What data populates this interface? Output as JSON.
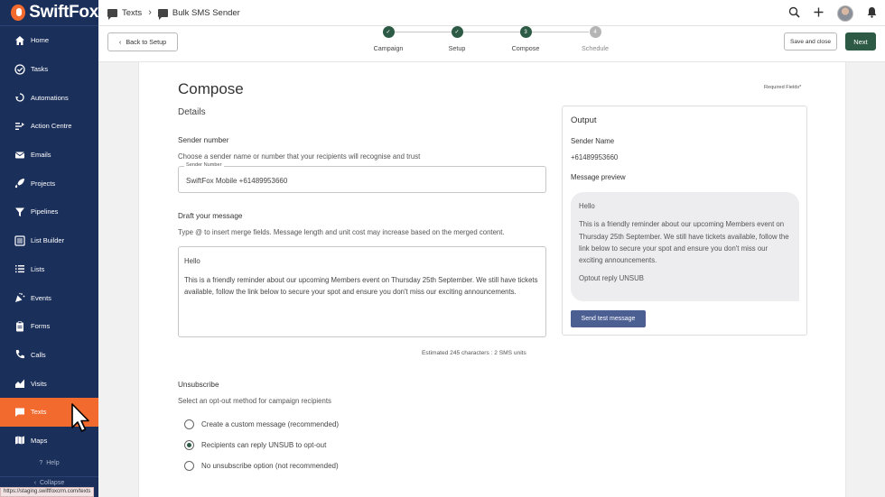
{
  "app": {
    "name": "SwiftFox"
  },
  "sidebar": {
    "items": [
      {
        "label": "Home",
        "icon": "home-icon"
      },
      {
        "label": "Tasks",
        "icon": "check-circle-icon"
      },
      {
        "label": "Automations",
        "icon": "refresh-icon"
      },
      {
        "label": "Action Centre",
        "icon": "action-centre-icon"
      },
      {
        "label": "Emails",
        "icon": "envelope-icon"
      },
      {
        "label": "Projects",
        "icon": "rocket-icon"
      },
      {
        "label": "Pipelines",
        "icon": "filter-icon"
      },
      {
        "label": "List Builder",
        "icon": "list-builder-icon"
      },
      {
        "label": "Lists",
        "icon": "list-icon"
      },
      {
        "label": "Events",
        "icon": "party-icon"
      },
      {
        "label": "Forms",
        "icon": "clipboard-icon"
      },
      {
        "label": "Calls",
        "icon": "phone-icon"
      },
      {
        "label": "Visits",
        "icon": "chart-icon"
      },
      {
        "label": "Texts",
        "icon": "message-icon",
        "active": true
      },
      {
        "label": "Maps",
        "icon": "map-icon"
      }
    ],
    "help": "Help",
    "collapse": "Collapse"
  },
  "breadcrumb": {
    "first": "Texts",
    "second": "Bulk SMS Sender"
  },
  "stepbar": {
    "back": "Back to Setup",
    "save": "Save and close",
    "next": "Next",
    "steps": [
      {
        "label": "Campaign",
        "num": ""
      },
      {
        "label": "Setup",
        "num": ""
      },
      {
        "label": "Compose",
        "num": "3"
      },
      {
        "label": "Schedule",
        "num": "4"
      }
    ]
  },
  "compose": {
    "title": "Compose",
    "required": "Required Fields*",
    "details": "Details",
    "sender_label": "Sender number",
    "sender_help": "Choose a sender name or number that your recipients will recognise and trust",
    "sender_field_label": "Sender Number",
    "sender_value": "SwiftFox Mobile +61489953660",
    "draft_label": "Draft your message",
    "draft_help": "Type @ to insert merge fields. Message length and unit cost may increase based on the merged content.",
    "message_greeting": "Hello",
    "message_body": "This is a friendly reminder about our upcoming Members event on Thursday 25th September. We still have tickets available, follow the link below to secure your spot and ensure you don't miss our exciting announcements.",
    "estimate": "Estimated 245 characters : 2 SMS units",
    "unsub_label": "Unsubscribe",
    "unsub_help": "Select an opt-out method for campaign recipients",
    "options": [
      {
        "label": "Create a custom message (recommended)",
        "selected": false
      },
      {
        "label": "Recipients can reply UNSUB to opt-out",
        "selected": true
      },
      {
        "label": "No unsubscribe option (not recommended)",
        "selected": false
      }
    ]
  },
  "output": {
    "title": "Output",
    "sender_name_label": "Sender Name",
    "sender_name_value": "+61489953660",
    "preview_label": "Message preview",
    "preview_greeting": "Hello",
    "preview_body": "This is a friendly reminder about our upcoming Members event on Thursday 25th September. We still have tickets available, follow the link below to secure your spot and ensure you don't miss our exciting announcements.",
    "preview_optout": "Optout reply UNSUB",
    "test_button": "Send test message"
  },
  "status_url": "https://staging.swiftfoxcrm.com/texts",
  "colors": {
    "sidebar": "#1b2f5b",
    "accent": "#f26a2e",
    "primary": "#2d5a45",
    "test_button": "#4b5f93"
  }
}
